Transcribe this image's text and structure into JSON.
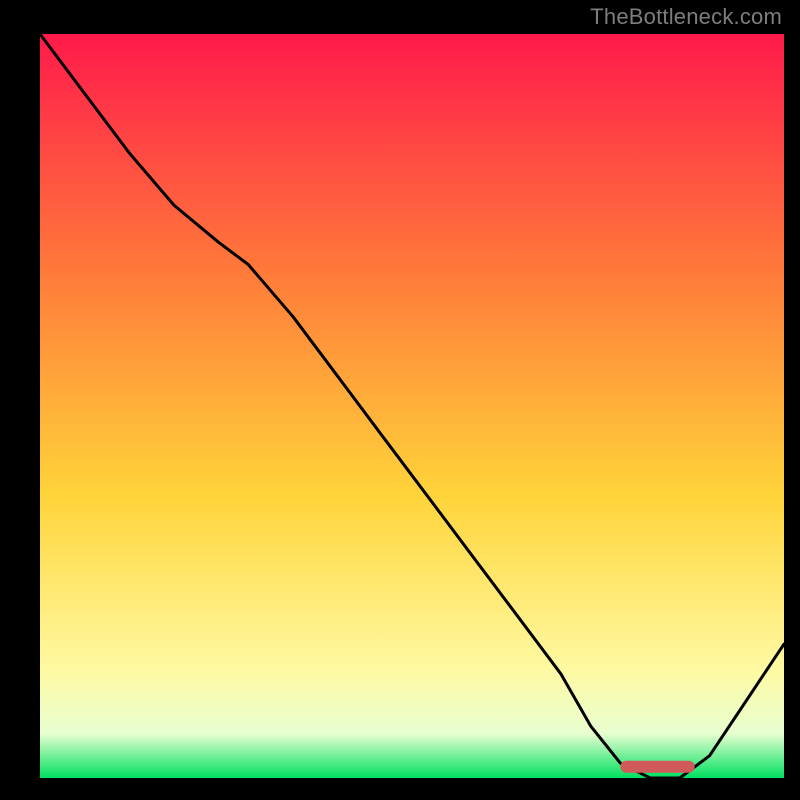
{
  "attribution": "TheBottleneck.com",
  "colors": {
    "frame": "#000000",
    "gradient_top": "#ff1a4b",
    "gradient_mid_upper": "#ff7a3a",
    "gradient_mid": "#ffd43a",
    "gradient_lower": "#fff9a0",
    "gradient_pale": "#e8ffd0",
    "gradient_bottom": "#00e060",
    "curve": "#000000",
    "marker": "#d05a5a"
  },
  "chart_data": {
    "type": "line",
    "title": "",
    "xlabel": "",
    "ylabel": "",
    "xlim": [
      0,
      100
    ],
    "ylim": [
      0,
      100
    ],
    "grid": false,
    "legend": false,
    "series": [
      {
        "name": "bottleneck-curve",
        "x": [
          0,
          6,
          12,
          18,
          24,
          28,
          34,
          40,
          46,
          52,
          58,
          64,
          70,
          74,
          78,
          82,
          86,
          90,
          94,
          100
        ],
        "y": [
          100,
          92,
          84,
          77,
          72,
          69,
          62,
          54,
          46,
          38,
          30,
          22,
          14,
          7,
          2,
          0,
          0,
          3,
          9,
          18
        ]
      }
    ],
    "annotations": [
      {
        "name": "optimum-zone",
        "shape": "rounded-bar",
        "x_start": 78,
        "x_end": 88,
        "y": 1.5
      }
    ]
  }
}
